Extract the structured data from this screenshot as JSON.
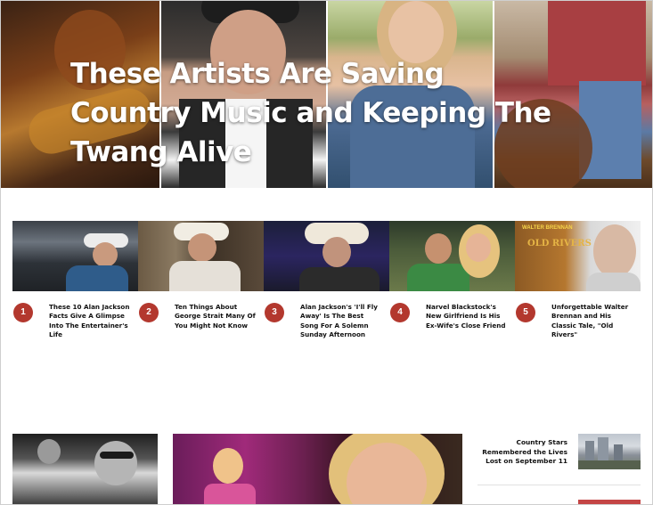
{
  "hero": {
    "title": "These Artists Are Saving Country Music and Keeping The Twang Alive"
  },
  "trending": {
    "items": [
      {
        "rank": "1",
        "title": "These 10 Alan Jackson Facts Give A Glimpse Into The Entertainer's Life"
      },
      {
        "rank": "2",
        "title": "Ten Things About George Strait Many Of You Might Not Know"
      },
      {
        "rank": "3",
        "title": "Alan Jackson's 'I'll Fly Away' Is The Best Song For A Solemn Sunday Afternoon"
      },
      {
        "rank": "4",
        "title": "Narvel Blackstock's New Girlfriend Is His Ex-Wife's Close Friend"
      },
      {
        "rank": "5",
        "title": "Unforgettable Walter Brennan and His Classic Tale, \"Old Rivers\""
      }
    ],
    "thumb5_caption": "WALTER BRENNAN",
    "thumb5_subcaption": "OLD RIVERS"
  },
  "sidebar": {
    "story_title": "Country Stars Remembered the Lives Lost on September 11"
  },
  "colors": {
    "rank_badge": "#b3382e",
    "hero_text": "#ffffff"
  }
}
